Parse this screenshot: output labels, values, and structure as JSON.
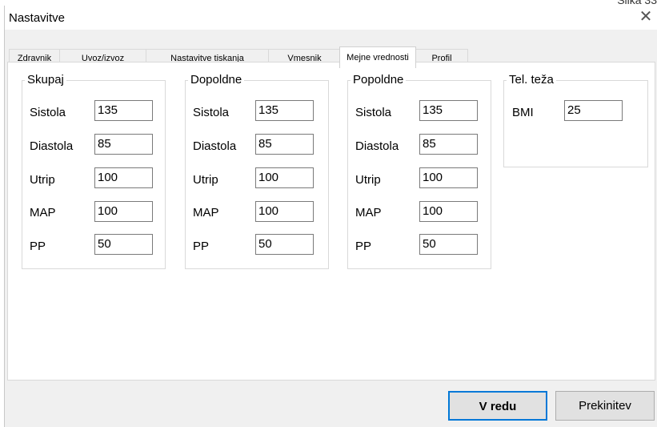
{
  "corner_text": "Slika 33",
  "dialog": {
    "title": "Nastavitve",
    "close_glyph": "✕"
  },
  "tabs": [
    {
      "label": "Zdravnik",
      "active": false
    },
    {
      "label": "Uvoz/izvoz",
      "active": false
    },
    {
      "label": "Nastavitve tiskanja",
      "active": false
    },
    {
      "label": "Vmesnik",
      "active": false
    },
    {
      "label": "Mejne vrednosti",
      "active": true
    },
    {
      "label": "Profil",
      "active": false
    }
  ],
  "groups": {
    "skupaj": {
      "title": "Skupaj",
      "fields": [
        {
          "label": "Sistola",
          "value": "135"
        },
        {
          "label": "Diastola",
          "value": "85"
        },
        {
          "label": "Utrip",
          "value": "100"
        },
        {
          "label": "MAP",
          "value": "100"
        },
        {
          "label": "PP",
          "value": "50"
        }
      ]
    },
    "dopoldne": {
      "title": "Dopoldne",
      "fields": [
        {
          "label": "Sistola",
          "value": "135"
        },
        {
          "label": "Diastola",
          "value": "85"
        },
        {
          "label": "Utrip",
          "value": "100"
        },
        {
          "label": "MAP",
          "value": "100"
        },
        {
          "label": "PP",
          "value": "50"
        }
      ]
    },
    "popoldne": {
      "title": "Popoldne",
      "fields": [
        {
          "label": "Sistola",
          "value": "135"
        },
        {
          "label": "Diastola",
          "value": "85"
        },
        {
          "label": "Utrip",
          "value": "100"
        },
        {
          "label": "MAP",
          "value": "100"
        },
        {
          "label": "PP",
          "value": "50"
        }
      ]
    },
    "teza": {
      "title": "Tel. teža",
      "fields": [
        {
          "label": "BMI",
          "value": "25"
        }
      ]
    }
  },
  "buttons": {
    "ok_label": "V redu",
    "cancel_label": "Prekinitev"
  },
  "colors": {
    "accent": "#0078d7",
    "dialog_bg": "#f0f0f0",
    "panel_bg": "#ffffff"
  }
}
